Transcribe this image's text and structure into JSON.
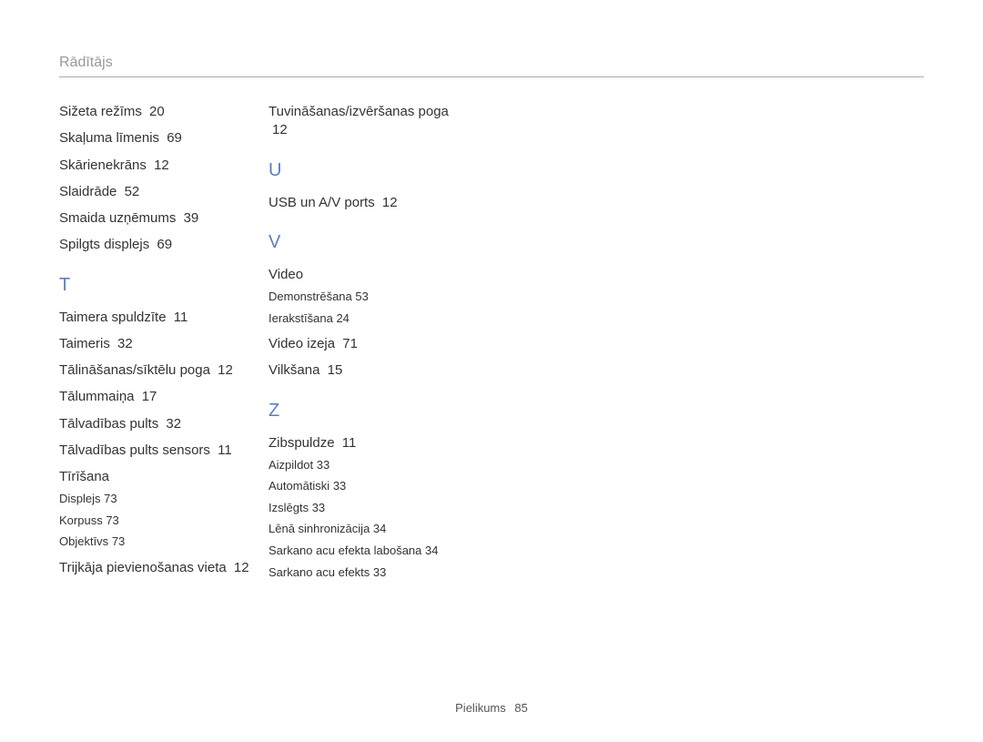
{
  "header": {
    "title": "Rādītājs"
  },
  "columns": [
    {
      "blocks": [
        {
          "type": "items",
          "items": [
            {
              "label": "Sižeta režīms",
              "page": "20"
            },
            {
              "label": "Skaļuma līmenis",
              "page": "69"
            },
            {
              "label": "Skārienekrāns",
              "page": "12"
            },
            {
              "label": "Slaidrāde",
              "page": "52"
            },
            {
              "label": "Smaida uzņēmums",
              "page": "39"
            },
            {
              "label": "Spilgts displejs",
              "page": "69"
            }
          ]
        },
        {
          "type": "letter",
          "letter": "T"
        },
        {
          "type": "items",
          "items": [
            {
              "label": "Taimera spuldzīte",
              "page": "11"
            },
            {
              "label": "Taimeris",
              "page": "32"
            },
            {
              "label": "Tālināšanas/sīktēlu poga",
              "page": "12"
            },
            {
              "label": "Tālummaiņa",
              "page": "17"
            },
            {
              "label": "Tālvadības pults",
              "page": "32"
            },
            {
              "label": "Tālvadības pults sensors",
              "page": "11"
            },
            {
              "label": "Tīrīšana",
              "sub": [
                {
                  "label": "Displejs",
                  "page": "73"
                },
                {
                  "label": "Korpuss",
                  "page": "73"
                },
                {
                  "label": "Objektīvs",
                  "page": "73"
                }
              ]
            },
            {
              "label": "Trijkāja pievienošanas vieta",
              "page": "12"
            }
          ]
        }
      ]
    },
    {
      "blocks": [
        {
          "type": "items",
          "items": [
            {
              "label": "Tuvināšanas/izvēršanas poga",
              "page": "12"
            }
          ]
        },
        {
          "type": "letter",
          "letter": "U"
        },
        {
          "type": "items",
          "items": [
            {
              "label": "USB un A/V ports",
              "page": "12"
            }
          ]
        },
        {
          "type": "letter",
          "letter": "V"
        },
        {
          "type": "items",
          "items": [
            {
              "label": "Video",
              "sub": [
                {
                  "label": "Demonstrēšana",
                  "page": "53"
                },
                {
                  "label": "Ierakstīšana",
                  "page": "24"
                }
              ]
            },
            {
              "label": "Video izeja",
              "page": "71"
            },
            {
              "label": "Vilkšana",
              "page": "15"
            }
          ]
        },
        {
          "type": "letter",
          "letter": "Z"
        },
        {
          "type": "items",
          "items": [
            {
              "label": "Zibspuldze",
              "page": "11",
              "sub": [
                {
                  "label": "Aizpildot",
                  "page": "33"
                },
                {
                  "label": "Automātiski",
                  "page": "33"
                },
                {
                  "label": "Izslēgts",
                  "page": "33"
                },
                {
                  "label": "Lēnā sinhronizācija",
                  "page": "34"
                },
                {
                  "label": "Sarkano acu efekta labošana",
                  "page": "34"
                },
                {
                  "label": "Sarkano acu efekts",
                  "page": "33"
                }
              ]
            }
          ]
        }
      ]
    }
  ],
  "footer": {
    "label": "Pielikums",
    "page": "85"
  }
}
